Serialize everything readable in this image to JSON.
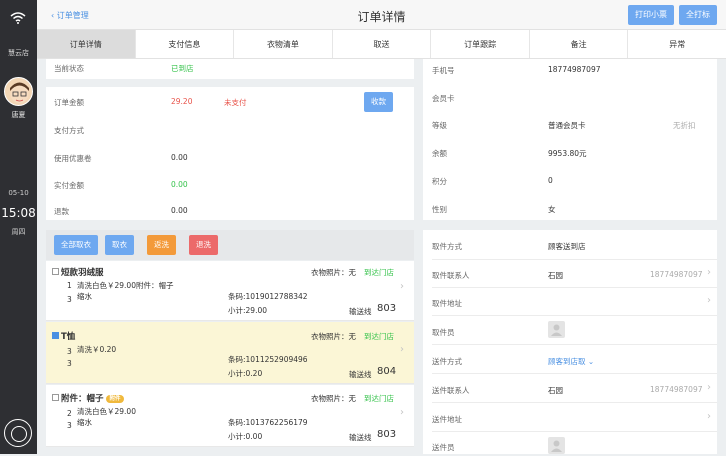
{
  "sidebar": {
    "store": "慧云店",
    "user_name": "唐夏",
    "date": "05-10",
    "time": "15:08",
    "weekday": "周四"
  },
  "header": {
    "back_label": "订单管理",
    "title": "订单详情",
    "print_receipt": "打印小票",
    "print_all": "全打标"
  },
  "tabs": [
    "订单详情",
    "支付信息",
    "衣物清单",
    "取送",
    "订单跟踪",
    "备注",
    "异常"
  ],
  "order": {
    "status_label": "当前状态",
    "status_value": "已到店",
    "amount_label": "订单金额",
    "amount_value": "29.20",
    "amount_status": "未支付",
    "collect_button": "收款",
    "pay_method_label": "支付方式",
    "coupon_label": "使用优惠卷",
    "coupon_value": "0.00",
    "actual_label": "实付金额",
    "actual_value": "0.00",
    "refund_label": "退款",
    "refund_value": "0.00"
  },
  "customer": {
    "phone_label": "手机号",
    "phone_value": "18774987097",
    "card_label": "会员卡",
    "level_label": "等级",
    "level_value": "普通会员卡",
    "discount": "无折扣",
    "balance_label": "余额",
    "balance_value": "9953.80元",
    "points_label": "积分",
    "points_value": "0",
    "gender_label": "性别",
    "gender_value": "女"
  },
  "actions": {
    "take_all": "全部取衣",
    "take": "取衣",
    "rewash": "返洗",
    "return": "退洗"
  },
  "items": [
    {
      "name": "短款羽绒服",
      "photo": "衣物照片：无",
      "status": "到达门店",
      "qty_top": "1",
      "qty_bottom": "3",
      "desc1": "清洗白色￥29.00附件：帽子",
      "desc2": "缩水",
      "barcode": "条码:1019012788342",
      "subtotal": "小计:29.00",
      "line_label": "输送线",
      "line_no": "803"
    },
    {
      "name": "T恤",
      "photo": "衣物照片：无",
      "status": "到达门店",
      "qty_top": "3",
      "qty_bottom": "3",
      "desc1": "清洗￥0.20",
      "desc2": "",
      "barcode": "条码:1011252909496",
      "subtotal": "小计:0.20",
      "line_label": "输送线",
      "line_no": "804"
    },
    {
      "name": "附件：帽子",
      "badge": "附件",
      "photo": "衣物照片：无",
      "status": "到达门店",
      "qty_top": "2",
      "qty_bottom": "3",
      "desc1": "清洗白色￥29.00",
      "desc2": "缩水",
      "barcode": "条码:1013762256179",
      "subtotal": "小计:0.00",
      "line_label": "输送线",
      "line_no": "803"
    }
  ],
  "delivery": {
    "pickup_method_label": "取件方式",
    "pickup_method_value": "顾客送到店",
    "pickup_contact_label": "取件联系人",
    "pickup_contact_name": "石园",
    "pickup_contact_phone": "18774987097",
    "pickup_address_label": "取件地址",
    "pickup_staff_label": "取件员",
    "send_method_label": "送件方式",
    "send_method_value": "顾客到店取",
    "send_contact_label": "送件联系人",
    "send_contact_name": "石园",
    "send_contact_phone": "18774987097",
    "send_address_label": "送件地址",
    "send_staff_label": "送件员"
  },
  "colors": {
    "accent": "#4a90e2",
    "button_blue": "#6ea8f0",
    "button_orange": "#f39a3a",
    "button_red": "#ec6a6a",
    "success": "#34c24a",
    "warning": "#e8534a"
  }
}
